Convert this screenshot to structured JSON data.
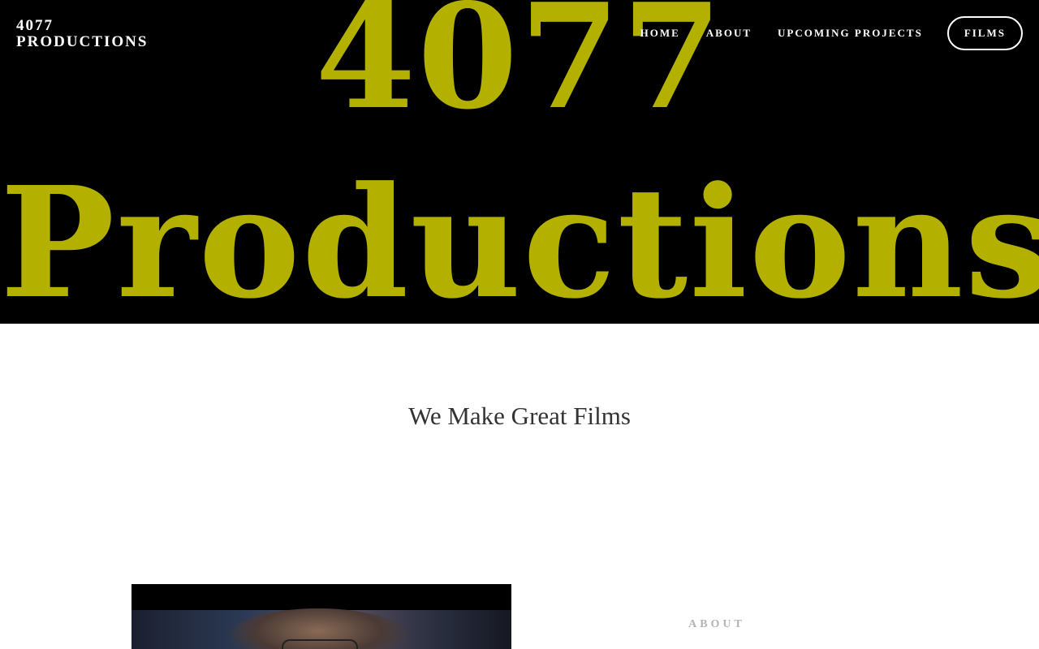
{
  "header": {
    "logo_line1": "4077",
    "logo_line2": "PRODUCTIONS",
    "nav": {
      "home": "HOME",
      "about": "ABOUT",
      "upcoming": "UPCOMING PROJECTS",
      "films": "FILMS"
    }
  },
  "hero": {
    "line1": "4077",
    "line2": "Productions",
    "text_color": "#b3b000",
    "background": "#000000"
  },
  "main": {
    "tagline": "We Make Great Films"
  },
  "about_section": {
    "label": "ABOUT"
  }
}
